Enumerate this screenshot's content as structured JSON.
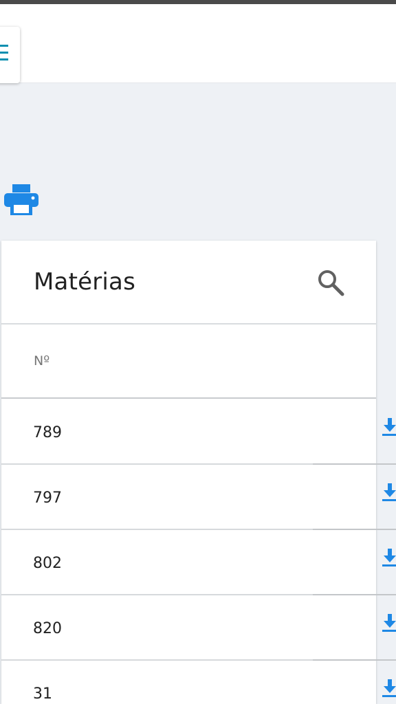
{
  "app": {
    "menu_icon": "hamburger-icon",
    "print_icon": "printer-icon"
  },
  "card": {
    "title": "Matérias",
    "search_icon": "search-icon",
    "column_header": "Nº"
  },
  "rows": [
    {
      "number": "789",
      "action_icon": "download-icon"
    },
    {
      "number": "797",
      "action_icon": "download-icon"
    },
    {
      "number": "802",
      "action_icon": "download-icon"
    },
    {
      "number": "820",
      "action_icon": "download-icon"
    },
    {
      "number": "31",
      "action_icon": "download-icon"
    }
  ],
  "colors": {
    "accent": "#1e88e5",
    "menu": "#0a8fb0",
    "background": "#eef1f5"
  }
}
